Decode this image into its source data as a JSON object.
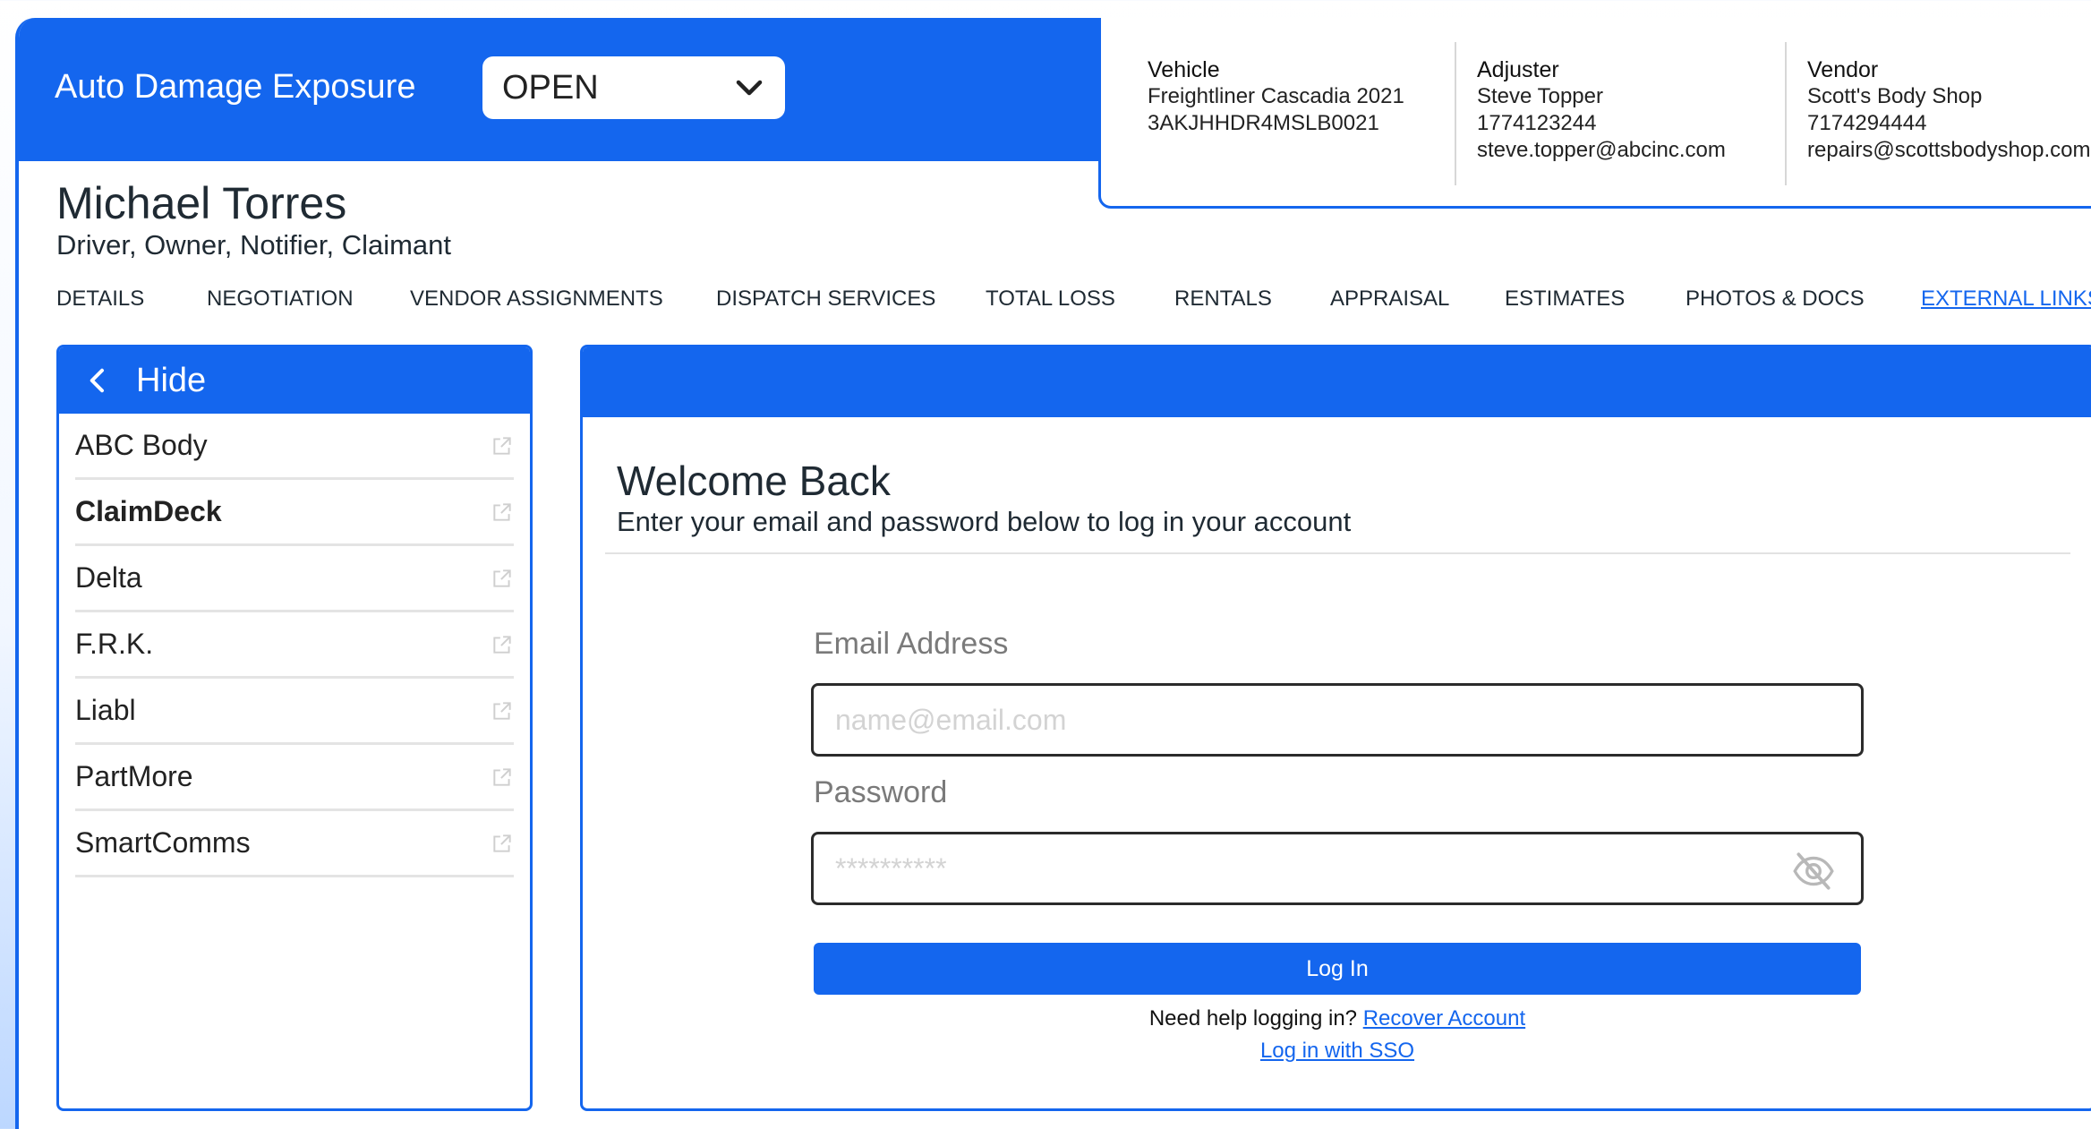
{
  "header": {
    "title": "Auto Damage Exposure",
    "status": "OPEN"
  },
  "info": {
    "vehicle": {
      "label": "Vehicle",
      "line1": "Freightliner Cascadia 2021",
      "line2": "3AKJHHDR4MSLB0021"
    },
    "adjuster": {
      "label": "Adjuster",
      "name": "Steve Topper",
      "phone": "1774123244",
      "email": "steve.topper@abcinc.com"
    },
    "vendor": {
      "label": "Vendor",
      "name": "Scott's Body Shop",
      "phone": "7174294444",
      "email": "repairs@scottsbodyshop.com"
    }
  },
  "person": {
    "name": "Michael Torres",
    "roles": "Driver, Owner, Notifier, Claimant"
  },
  "tabs": [
    {
      "label": "DETAILS"
    },
    {
      "label": "NEGOTIATION"
    },
    {
      "label": "VENDOR ASSIGNMENTS"
    },
    {
      "label": "DISPATCH SERVICES"
    },
    {
      "label": "TOTAL LOSS"
    },
    {
      "label": "RENTALS"
    },
    {
      "label": "APPRAISAL"
    },
    {
      "label": "ESTIMATES"
    },
    {
      "label": "PHOTOS & DOCS"
    },
    {
      "label": "EXTERNAL LINKS"
    }
  ],
  "active_tab": "EXTERNAL LINKS",
  "sidebar": {
    "hide_label": "Hide",
    "items": [
      {
        "label": "ABC Body"
      },
      {
        "label": "ClaimDeck"
      },
      {
        "label": "Delta"
      },
      {
        "label": "F.R.K."
      },
      {
        "label": "Liabl"
      },
      {
        "label": "PartMore"
      },
      {
        "label": "SmartComms"
      }
    ],
    "selected": "ClaimDeck"
  },
  "login": {
    "title": "Welcome Back",
    "subtitle": "Enter your email and password below to log in your account",
    "email_label": "Email Address",
    "email_placeholder": "name@email.com",
    "password_label": "Password",
    "password_placeholder": "**********",
    "button_label": "Log In",
    "help_text": "Need help logging in?",
    "recover_link": "Recover Account",
    "sso_link": "Log in with SSO"
  },
  "colors": {
    "brand_blue": "#1466ee",
    "text_dark": "#1f2a33",
    "field_label_gray": "#7a7a7a"
  }
}
